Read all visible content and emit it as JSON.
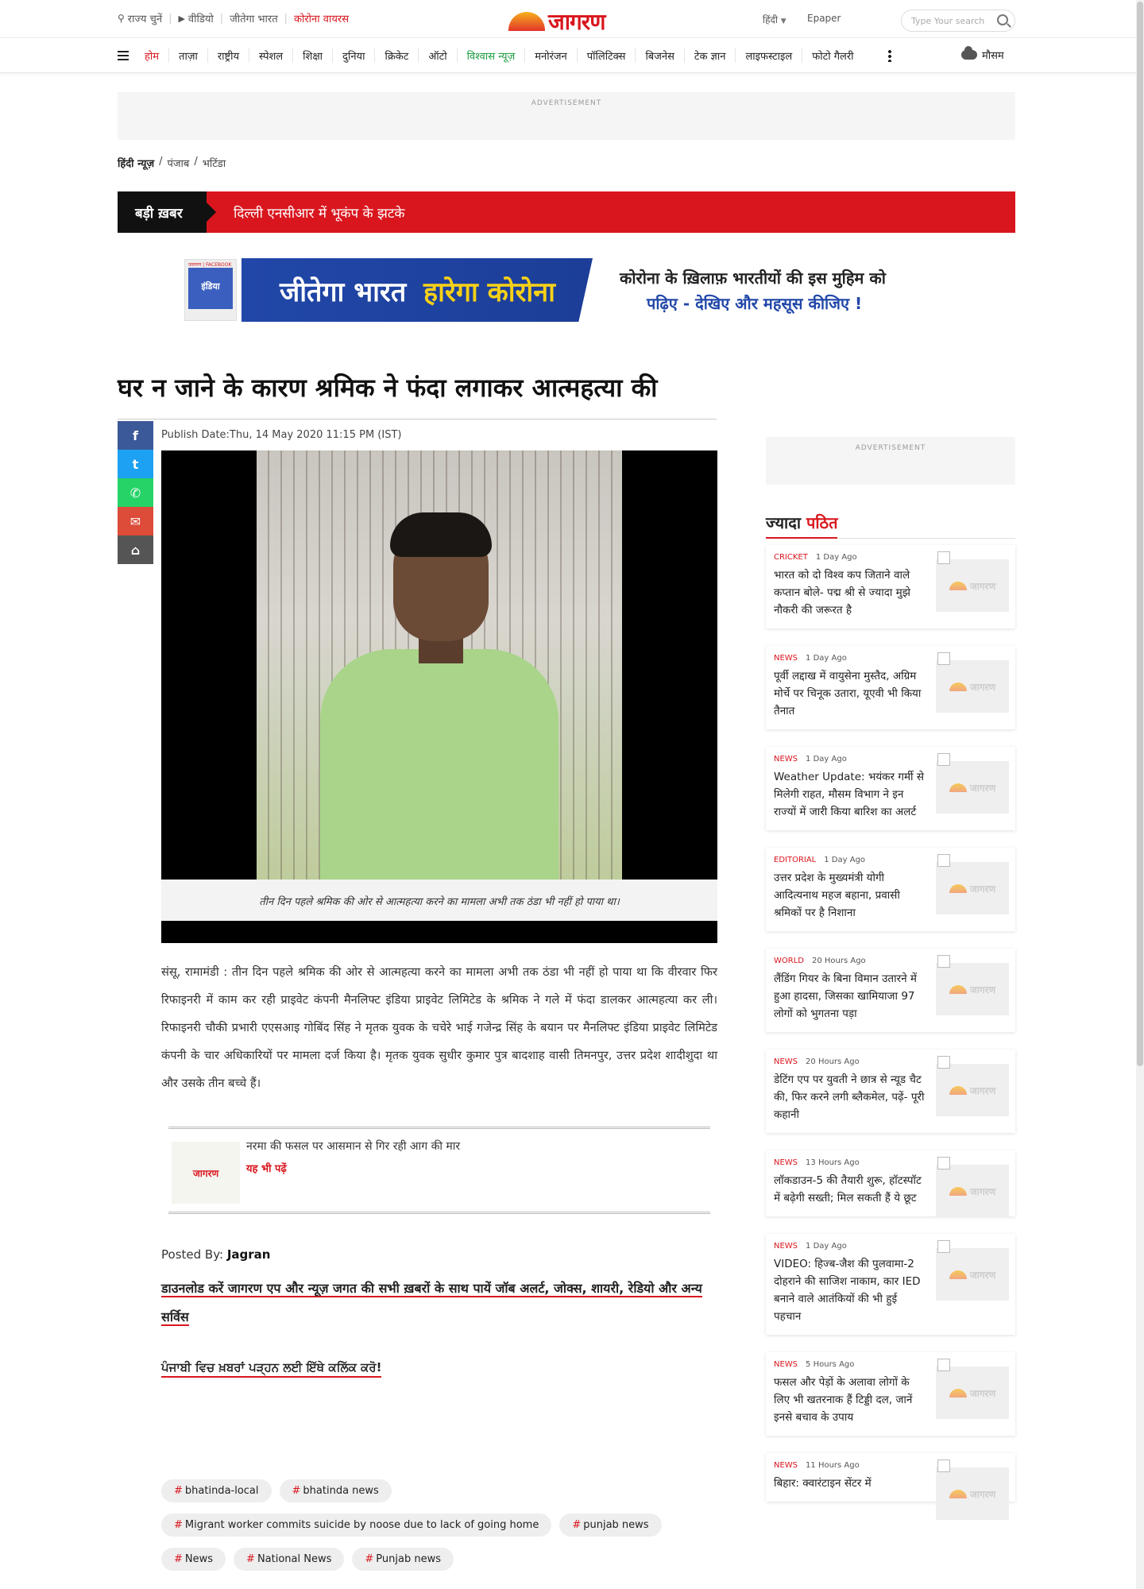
{
  "topbar": {
    "state": "राज्य चुनें",
    "video": "वीडियो",
    "jeetega": "जीतेगा भारत",
    "corona": "कोरोना वायरस",
    "logo": "जागरण",
    "lang": "हिंदी",
    "epaper": "Epaper",
    "search_placeholder": "Type Your search"
  },
  "nav": [
    "होम",
    "ताज़ा",
    "राष्ट्रीय",
    "स्पेशल",
    "शिक्षा",
    "दुनिया",
    "क्रिकेट",
    "ऑटो",
    "विश्वास न्यूज़",
    "मनोरंजन",
    "पॉलिटिक्स",
    "बिजनेस",
    "टेक ज्ञान",
    "लाइफस्टाइल",
    "फोटो गैलरी"
  ],
  "weather": "मौसम",
  "ad_label": "ADVERTISEMENT",
  "breadcrumb": [
    "हिंदी न्यूज़",
    "पंजाब",
    "भटिंडा"
  ],
  "breaking": {
    "tag": "बड़ी ख़बर",
    "headline": "दिल्ली एनसीआर में भूकंप के झटके"
  },
  "banner": {
    "mini_top": "जागरण | FACEBOOK",
    "mini_text": "इंडिया",
    "blue_a": "जीतेगा भारत",
    "blue_b": "हारेगा कोरोना",
    "line1": "कोरोना के ख़िलाफ़ भारतीयों की इस मुहिम को",
    "line2": "पढ़िए - देखिए और महसूस कीजिए !"
  },
  "article": {
    "title": "घर न जाने के कारण श्रमिक ने फंदा लगाकर आत्महत्या की",
    "publish": "Publish Date:Thu, 14 May 2020 11:15 PM (IST)",
    "caption": "तीन दिन पहले श्रमिक की ओर से आत्महत्या करने का मामला अभी तक ठंडा भी नहीं हो पाया था।",
    "body": "संसू, रामामंडी : तीन दिन पहले श्रमिक की ओर से आत्महत्या करने का मामला अभी तक ठंडा भी नहीं हो पाया था कि वीरवार फिर रिफाइनरी में काम कर रही प्राइवेट कंपनी मैनलिफ्ट इंडिया प्राइवेट लिमिटेड के श्रमिक ने गले में फंदा डालकर आत्महत्या कर ली। रिफाइनरी चौकी प्रभारी एएसआइ गोबिंद सिंह ने मृतक युवक के चचेरे भाई गजेन्द्र सिंह के बयान पर मैनलिफ्ट इंडिया प्राइवेट लिमिटेड कंपनी के चार अधिकारियों पर मामला दर्ज किया है। मृतक युवक सुधीर कुमार पुत्र बादशाह वासी तिमनपुर, उत्तर प्रदेश शादीशुदा था और उसके तीन बच्चे हैं।",
    "also_title": "नरमा की फसल पर आसमान से गिर रही आग की मार",
    "also_more": "यह भी पढ़ें",
    "also_logo": "जागरण",
    "posted_label": "Posted By:",
    "posted_by": "Jagran",
    "download": "डाउनलोड करें जागरण एप और न्यूज़ जगत की सभी ख़बरों के साथ पायें जॉब अलर्ट, जोक्स, शायरी, रेडियो और अन्य सर्विस",
    "punjabi": "ਪੰਜਾਬੀ ਵਿਚ ਖ਼ਬਰਾਂ ਪੜ੍ਹਨ ਲਈ ਇੱਥੇ ਕਲਿੱਕ ਕਰੋ!"
  },
  "tags": [
    "bhatinda-local",
    "bhatinda news",
    "Migrant worker commits suicide by noose due to lack of going home",
    "punjab news",
    "News",
    "National News",
    "Punjab news"
  ],
  "sidebar": {
    "head_a": "ज्यादा",
    "head_b": "पठित",
    "img_text": "जागरण",
    "items": [
      {
        "cat": "CRICKET",
        "time": "1 Day Ago",
        "title": "भारत को दो विश्व कप जिताने वाले कप्तान बोले- पद्म श्री से ज्यादा मुझे नौकरी की जरूरत है"
      },
      {
        "cat": "NEWS",
        "time": "1 Day Ago",
        "title": "पूर्वी लद्दाख में वायुसेना मुस्तैद, अग्रिम मोर्चे पर चिनूक उतारा, यूएवी भी किया तैनात"
      },
      {
        "cat": "NEWS",
        "time": "1 Day Ago",
        "title": "Weather Update: भयंकर गर्मी से मिलेगी राहत, मौसम विभाग ने इन राज्यों में जारी किया बारिश का अलर्ट"
      },
      {
        "cat": "EDITORIAL",
        "time": "1 Day Ago",
        "title": "उत्तर प्रदेश के मुख्यमंत्री योगी आदित्यनाथ महज बहाना, प्रवासी श्रमिकों पर है निशाना"
      },
      {
        "cat": "WORLD",
        "time": "20 Hours Ago",
        "title": "लैंडिंग गियर के बिना विमान उतारने में हुआ हादसा, जिसका खामियाजा 97 लोगों को भुगतना पड़ा"
      },
      {
        "cat": "NEWS",
        "time": "20 Hours Ago",
        "title": "डेटिंग एप पर युवती ने छात्र से न्यूड चैट की, फिर करने लगी ब्लैकमेल, पढ़ें- पूरी कहानी"
      },
      {
        "cat": "NEWS",
        "time": "13 Hours Ago",
        "title": "लॉकडाउन-5 की तैयारी शुरू, हॉटस्पॉट में बढ़ेगी सख्ती; मिल सकती हैं ये छूट"
      },
      {
        "cat": "NEWS",
        "time": "1 Day Ago",
        "title": "VIDEO: हिज्ब-जैश की पुलवामा-2 दोहराने की साजिश नाकाम, कार IED बनाने वाले आतंकियों की भी हुई पहचान"
      },
      {
        "cat": "NEWS",
        "time": "5 Hours Ago",
        "title": "फसल और पेड़ों के अलावा लोगों के लिए भी खतरनाक हैं टिड्डी दल, जानें इनसे बचाव के उपाय"
      },
      {
        "cat": "NEWS",
        "time": "11 Hours Ago",
        "title": "बिहार: क्वारंटाइन सेंटर में"
      }
    ]
  }
}
